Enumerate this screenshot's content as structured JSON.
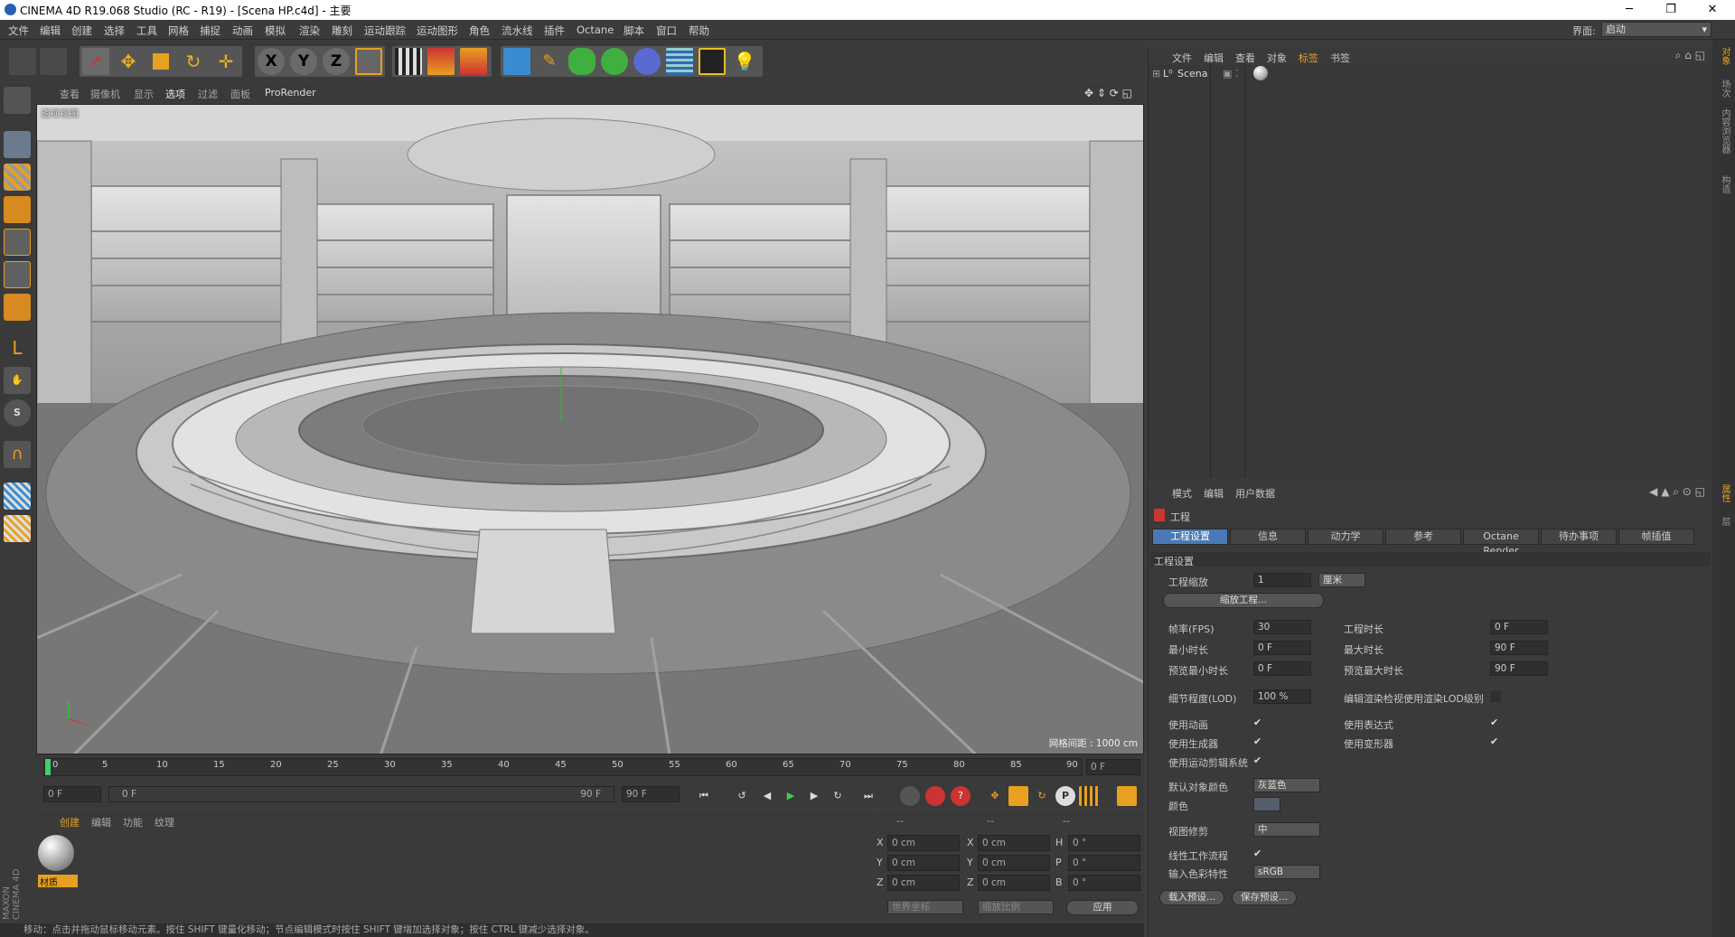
{
  "window": {
    "title": "CINEMA 4D R19.068 Studio (RC - R19) - [Scena HP.c4d] - 主要",
    "minimize": "─",
    "maximize": "❐",
    "close": "✕"
  },
  "menu": [
    "文件",
    "编辑",
    "创建",
    "选择",
    "工具",
    "网格",
    "捕捉",
    "动画",
    "模拟",
    "渲染",
    "雕刻",
    "运动跟踪",
    "运动图形",
    "角色",
    "流水线",
    "插件",
    "Octane",
    "脚本",
    "窗口",
    "帮助"
  ],
  "layout": {
    "label": "界面:",
    "value": "启动"
  },
  "viewport": {
    "menu": [
      "查看",
      "摄像机",
      "显示",
      "选项",
      "过滤",
      "面板",
      "ProRender"
    ],
    "label": "透视视图",
    "grid_distance": "网格间距 : 1000 cm"
  },
  "timeline": {
    "ticks": [
      "0",
      "5",
      "10",
      "15",
      "20",
      "25",
      "30",
      "35",
      "40",
      "45",
      "50",
      "55",
      "60",
      "65",
      "70",
      "75",
      "80",
      "85",
      "90"
    ],
    "current": "0 F"
  },
  "transport": {
    "start": "0 F",
    "range_start": "0 F",
    "range_end": "90 F",
    "end": "90 F"
  },
  "material_manager": {
    "menu": [
      "创建",
      "编辑",
      "功能",
      "纹理"
    ],
    "material_label": "材质"
  },
  "coordinates": {
    "headers": [
      "--",
      "--",
      "--"
    ],
    "rows": [
      {
        "a": "X",
        "av": "0 cm",
        "b": "X",
        "bv": "0 cm",
        "c": "H",
        "cv": "0 °"
      },
      {
        "a": "Y",
        "av": "0 cm",
        "b": "Y",
        "bv": "0 cm",
        "c": "P",
        "cv": "0 °"
      },
      {
        "a": "Z",
        "av": "0 cm",
        "b": "Z",
        "bv": "0 cm",
        "c": "B",
        "cv": "0 °"
      }
    ],
    "world": "世界坐标",
    "scale": "缩放比例",
    "apply": "应用"
  },
  "statusbar": "移动：点击并拖动鼠标移动元素。按住 SHIFT 键量化移动；节点编辑模式时按住 SHIFT 键增加选择对象；按住 CTRL 键减少选择对象。",
  "objects": {
    "menu": [
      "文件",
      "编辑",
      "查看",
      "对象",
      "标签",
      "书签"
    ],
    "items": [
      {
        "name": "Scena"
      }
    ]
  },
  "attributes": {
    "menu": [
      "模式",
      "编辑",
      "用户数据"
    ],
    "title": "工程",
    "tabs": [
      "工程设置",
      "信息",
      "动力学",
      "参考",
      "Octane Render",
      "待办事项",
      "帧插值"
    ],
    "section": "工程设置",
    "scale_label": "工程缩放",
    "scale_value": "1",
    "scale_unit": "厘米",
    "scale_button": "缩放工程...",
    "fps_label": "帧率(FPS)",
    "fps_value": "30",
    "duration_label": "工程时长",
    "duration_value": "0 F",
    "min_label": "最小时长",
    "min_value": "0 F",
    "max_label": "最大时长",
    "max_value": "90 F",
    "pmin_label": "预览最小时长",
    "pmin_value": "0 F",
    "pmax_label": "预览最大时长",
    "pmax_value": "90 F",
    "lod_label": "细节程度(LOD)",
    "lod_value": "100 %",
    "lod_render_label": "编辑渲染检视使用渲染LOD级别",
    "anim_label": "使用动画",
    "expr_label": "使用表达式",
    "gen_label": "使用生成器",
    "deform_label": "使用变形器",
    "motion_label": "使用运动剪辑系统",
    "objcolor_label": "默认对象颜色",
    "objcolor_value": "灰蓝色",
    "color_label": "颜色",
    "clip_label": "视图修剪",
    "clip_value": "中",
    "linear_label": "线性工作流程",
    "profile_label": "输入色彩特性",
    "profile_value": "sRGB",
    "load_preset": "载入预设...",
    "save_preset": "保存预设...",
    "check": "✔"
  },
  "right_strip": [
    "对象",
    "场次",
    "内容浏览器",
    "构造",
    "属性",
    "层"
  ]
}
